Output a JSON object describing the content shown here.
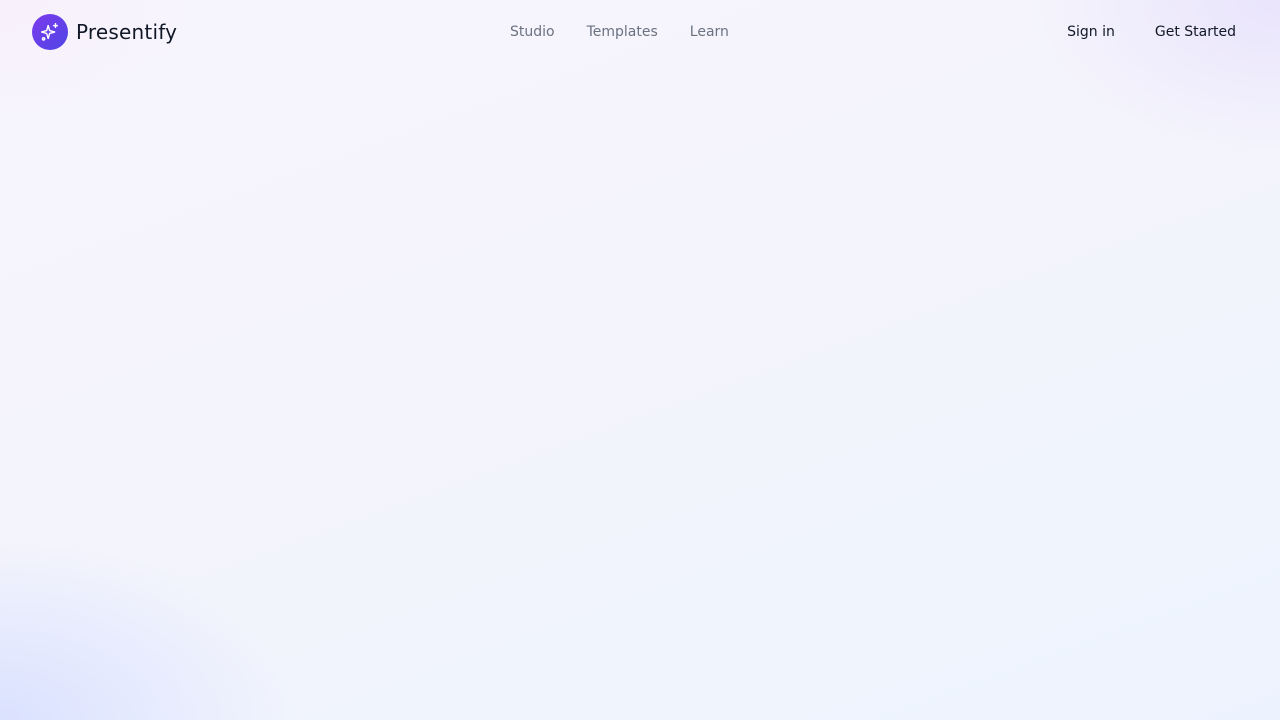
{
  "brand": {
    "name": "Presentify",
    "logo_icon": "sparkles-icon",
    "logo_gradient": [
      "#7c3aed",
      "#4f46e5"
    ]
  },
  "nav": {
    "items": [
      {
        "label": "Studio"
      },
      {
        "label": "Templates"
      },
      {
        "label": "Learn"
      }
    ]
  },
  "actions": {
    "sign_in_label": "Sign in",
    "get_started_label": "Get Started"
  },
  "colors": {
    "text_primary": "#111827",
    "text_muted": "#6b7280",
    "background": "#f5f4fd"
  }
}
